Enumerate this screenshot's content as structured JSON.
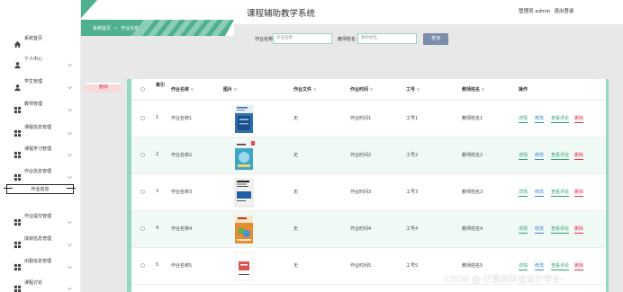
{
  "app": {
    "title": "课程辅助教学系统",
    "user_label": "管理员 admin",
    "logout_label": "退出登录",
    "accent_color": "#95d7c0",
    "banner_color": "#4fb08d"
  },
  "breadcrumb": [
    "系统首页",
    "»",
    "作业信息"
  ],
  "sidebar": {
    "items": [
      {
        "label": "系统首页",
        "icon": "home-icon"
      },
      {
        "label": "个人中心",
        "icon": "user-icon"
      },
      {
        "label": "学生管理",
        "icon": "user-icon"
      },
      {
        "label": "教师管理",
        "icon": "grid-icon"
      },
      {
        "label": "课程信息管理",
        "icon": "grid-icon"
      },
      {
        "label": "课程学习管理",
        "icon": "grid-icon"
      },
      {
        "label": "作业信息管理",
        "icon": "grid-icon"
      },
      {
        "label": "作业提交管理",
        "icon": "grid-icon"
      },
      {
        "label": "成绩信息管理",
        "icon": "grid-icon"
      },
      {
        "label": "出勤信息管理",
        "icon": "grid-icon"
      },
      {
        "label": "课程讨论",
        "icon": "grid-icon"
      }
    ],
    "active_sub": "作业信息"
  },
  "search": {
    "field1_label": "作业名称",
    "field1_placeholder": "作业名称",
    "field2_label": "教师姓名",
    "field2_placeholder": "教师姓名",
    "button_label": "查询"
  },
  "toolbar": {
    "delete_label": "删除"
  },
  "table": {
    "headers": {
      "index": "索引",
      "name": "作业名称",
      "image": "图片",
      "file": "作业文件",
      "time": "作业时间",
      "job_no": "工号",
      "teacher": "教师姓名",
      "ops": "操作"
    },
    "rows": [
      {
        "index": "1",
        "name": "作业名称1",
        "file": "无",
        "time": "作业时间1",
        "job_no": "工号1",
        "teacher": "教师姓名1"
      },
      {
        "index": "2",
        "name": "作业名称2",
        "file": "无",
        "time": "作业时间2",
        "job_no": "工号2",
        "teacher": "教师姓名2"
      },
      {
        "index": "3",
        "name": "作业名称3",
        "file": "无",
        "time": "作业时间3",
        "job_no": "工号3",
        "teacher": "教师姓名3"
      },
      {
        "index": "4",
        "name": "作业名称4",
        "file": "无",
        "time": "作业时间4",
        "job_no": "工号4",
        "teacher": "教师姓名4"
      },
      {
        "index": "5",
        "name": "作业名称5",
        "file": "无",
        "time": "作业时间5",
        "job_no": "工号5",
        "teacher": "教师姓名5"
      }
    ],
    "actions": {
      "detail": "详情",
      "edit": "修改",
      "review": "查看评论",
      "delete": "删除"
    }
  },
  "watermark": "CSDN @-计算机毕业设计学长-"
}
